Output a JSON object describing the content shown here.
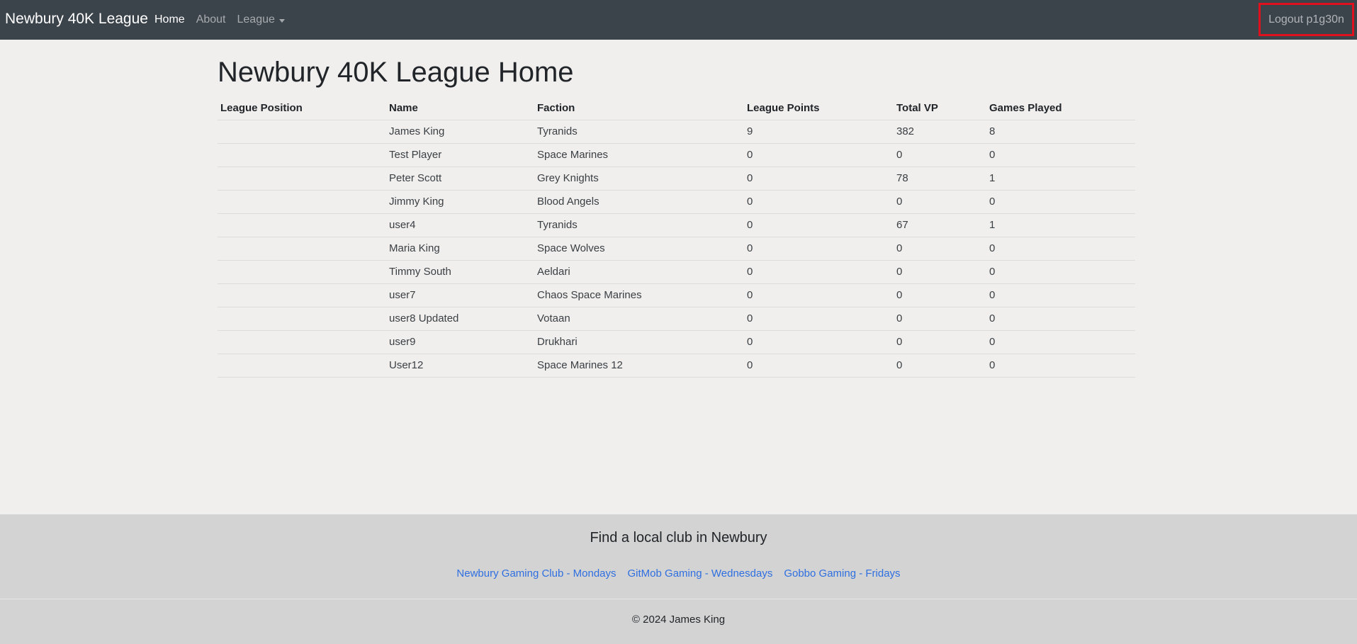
{
  "navbar": {
    "brand": "Newbury 40K League",
    "links": [
      {
        "label": "Home",
        "active": true
      },
      {
        "label": "About",
        "active": false
      }
    ],
    "dropdown_label": "League",
    "logout_label": "Logout p1g30n"
  },
  "main": {
    "title": "Newbury 40K League Home",
    "table": {
      "headers": [
        "League Position",
        "Name",
        "Faction",
        "League Points",
        "Total VP",
        "Games Played"
      ],
      "rows": [
        [
          "",
          "James King",
          "Tyranids",
          "9",
          "382",
          "8"
        ],
        [
          "",
          "Test Player",
          "Space Marines",
          "0",
          "0",
          "0"
        ],
        [
          "",
          "Peter Scott",
          "Grey Knights",
          "0",
          "78",
          "1"
        ],
        [
          "",
          "Jimmy King",
          "Blood Angels",
          "0",
          "0",
          "0"
        ],
        [
          "",
          "user4",
          "Tyranids",
          "0",
          "67",
          "1"
        ],
        [
          "",
          "Maria King",
          "Space Wolves",
          "0",
          "0",
          "0"
        ],
        [
          "",
          "Timmy South",
          "Aeldari",
          "0",
          "0",
          "0"
        ],
        [
          "",
          "user7",
          "Chaos Space Marines",
          "0",
          "0",
          "0"
        ],
        [
          "",
          "user8 Updated",
          "Votaan",
          "0",
          "0",
          "0"
        ],
        [
          "",
          "user9",
          "Drukhari",
          "0",
          "0",
          "0"
        ],
        [
          "",
          "User12",
          "Space Marines 12",
          "0",
          "0",
          "0"
        ]
      ]
    }
  },
  "footer": {
    "heading": "Find a local club in Newbury",
    "links": [
      "Newbury Gaming Club - Mondays",
      "GitMob Gaming - Wednesdays",
      "Gobbo Gaming - Fridays"
    ],
    "copyright": "© 2024 James King"
  },
  "colors": {
    "navbar_bg": "#3b434b",
    "page_bg": "#f0efed",
    "footer_bg": "#d3d3d3",
    "link": "#2f6fe0",
    "highlight_box": "#e0101c"
  }
}
